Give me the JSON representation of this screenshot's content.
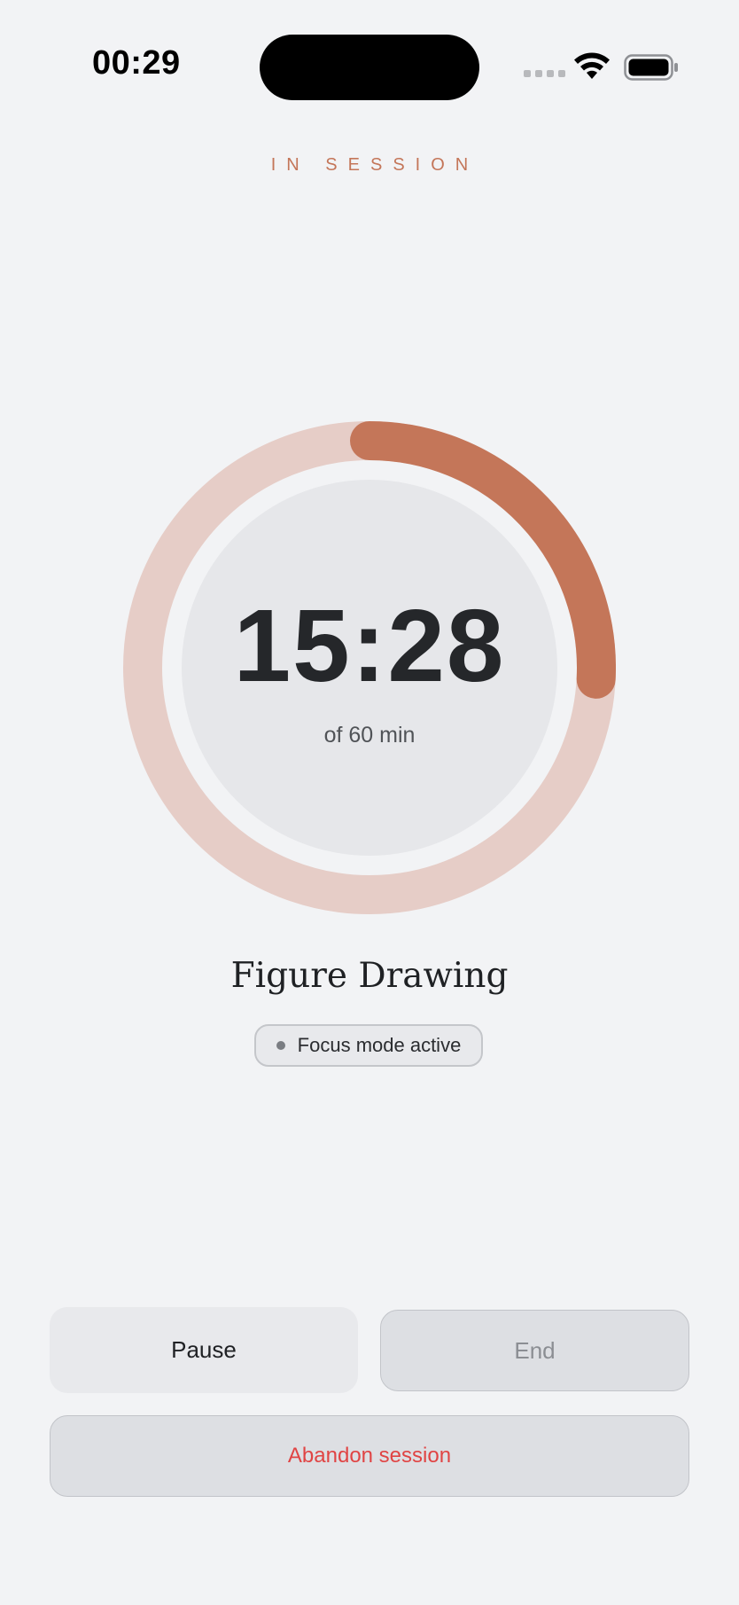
{
  "status_bar": {
    "time": "00:29",
    "icons": [
      "cellular-signal-icon",
      "wifi-icon",
      "battery-icon"
    ]
  },
  "header": {
    "label": "IN SESSION"
  },
  "timer": {
    "value": "15:28",
    "total": "of 60 min",
    "progress": 0.258
  },
  "activity": {
    "title": "Figure Drawing",
    "badge": "Focus mode active"
  },
  "actions": {
    "pause": "Pause",
    "end": "End",
    "abandon": "Abandon session"
  },
  "colors": {
    "accent": "#c47659",
    "ring_track": "#e6cdc7",
    "background": "#f2f3f5",
    "danger": "#e04444"
  }
}
